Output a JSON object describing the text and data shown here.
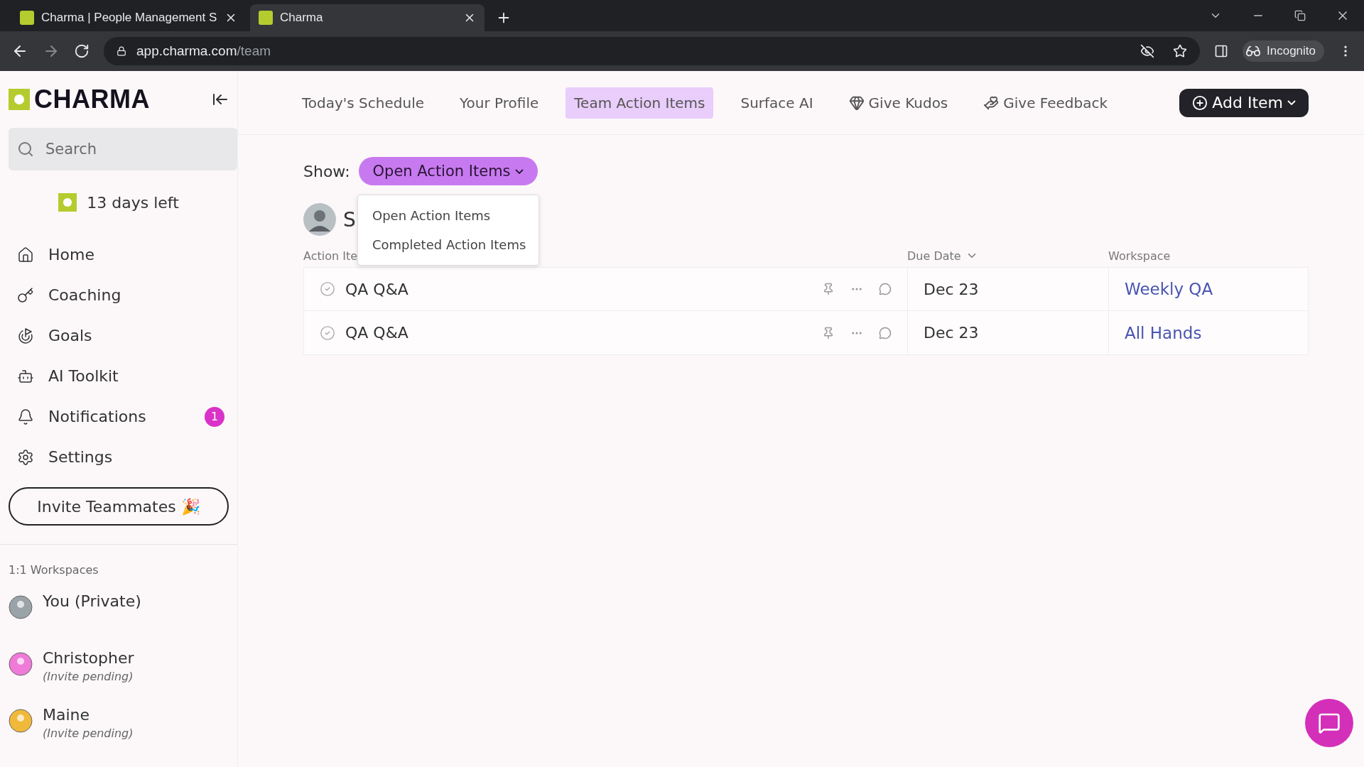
{
  "browser": {
    "tabs": [
      {
        "title": "Charma | People Management S",
        "selected": false
      },
      {
        "title": "Charma",
        "selected": true
      }
    ],
    "url_host": "app.charma.com",
    "url_path": "/team",
    "profile": "Incognito"
  },
  "sidebar": {
    "logo": "CHARMA",
    "search": {
      "placeholder": "Search"
    },
    "trial": "13 days left",
    "items": [
      {
        "label": "Home"
      },
      {
        "label": "Coaching"
      },
      {
        "label": "Goals"
      },
      {
        "label": "AI Toolkit"
      },
      {
        "label": "Notifications",
        "badge": "1"
      },
      {
        "label": "Settings"
      }
    ],
    "invite_button": "Invite Teammates 🎉",
    "workspaces_heading": "1:1 Workspaces",
    "workspaces": [
      {
        "name": "You (Private)"
      },
      {
        "name": "Christopher",
        "status": "(Invite pending)"
      },
      {
        "name": "Maine",
        "status": "(Invite pending)"
      }
    ]
  },
  "nav": {
    "tabs": [
      {
        "label": "Today's Schedule",
        "selected": false
      },
      {
        "label": "Your Profile",
        "selected": false
      },
      {
        "label": "Team Action Items",
        "selected": true
      },
      {
        "label": "Surface AI",
        "selected": false
      },
      {
        "label": "Give Kudos",
        "selected": false
      },
      {
        "label": "Give Feedback",
        "selected": false
      }
    ],
    "add_button": "Add Item"
  },
  "filter": {
    "label": "Show:",
    "value": "Open Action Items",
    "menu": [
      "Open Action Items",
      "Completed Action Items"
    ]
  },
  "person_initial": "S",
  "table": {
    "columns": [
      "Action Ite",
      "Due Date",
      "Workspace"
    ],
    "rows": [
      {
        "item": "QA Q&A",
        "due": "Dec 23",
        "workspace": "Weekly QA"
      },
      {
        "item": "QA Q&A",
        "due": "Dec 23",
        "workspace": "All Hands"
      }
    ]
  }
}
